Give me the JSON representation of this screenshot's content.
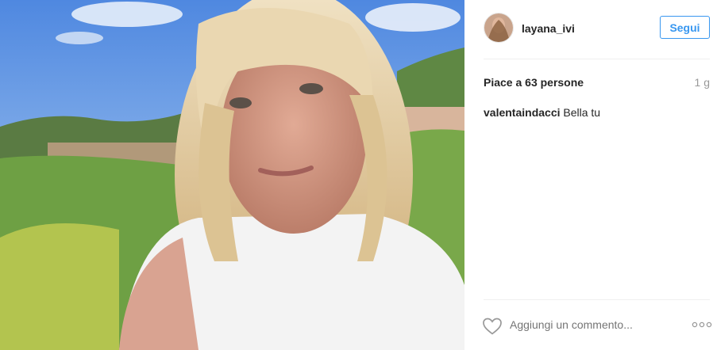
{
  "post": {
    "author": {
      "username": "layana_ivi"
    },
    "follow_label": "Segui",
    "likes_text": "Piace a 63 persone",
    "age_text": "1 g",
    "comments": [
      {
        "user": "valentaindacci",
        "text": "Bella tu"
      }
    ],
    "comment_placeholder": "Aggiungi un commento...",
    "colors": {
      "accent": "#3897f0",
      "muted": "#999999",
      "text": "#262626",
      "divider": "#efefef"
    },
    "icons": {
      "like": "heart-outline-icon",
      "options": "ellipsis-icon"
    }
  }
}
